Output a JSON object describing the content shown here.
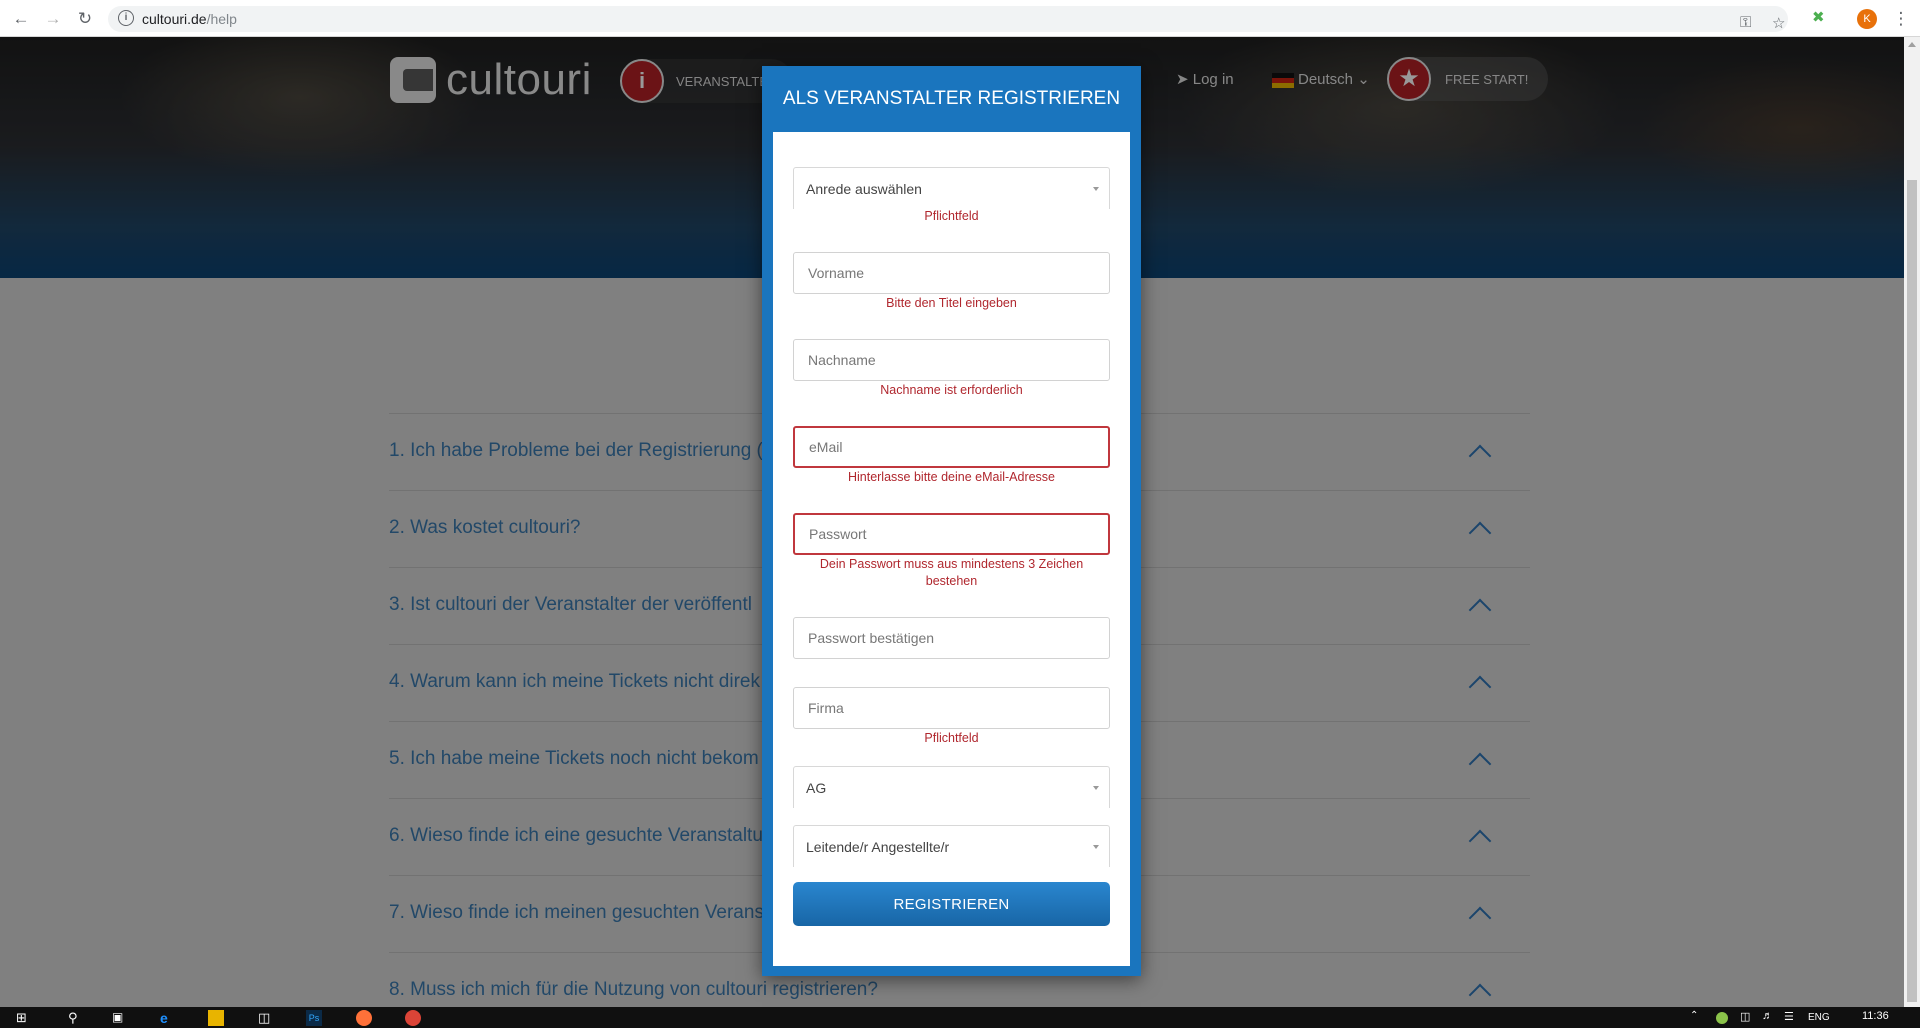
{
  "browser": {
    "url_host": "cultouri.de",
    "url_path": "/help",
    "avatar_letter": "K"
  },
  "header": {
    "logo_text": "cultouri",
    "veranstalter_label": "VERANSTALTER",
    "login_label": "Log in",
    "language_label": "Deutsch",
    "free_start_label": "FREE START!"
  },
  "faq": {
    "items": [
      {
        "question": "1. Ich habe Probleme bei der Registrierung ("
      },
      {
        "question": "2. Was kostet cultouri?"
      },
      {
        "question": "3. Ist cultouri der Veranstalter der veröffentl"
      },
      {
        "question": "4. Warum kann ich meine Tickets nicht direk"
      },
      {
        "question": "5. Ich habe meine Tickets noch nicht bekom"
      },
      {
        "question": "6. Wieso finde ich eine gesuchte Veranstaltu"
      },
      {
        "question": "7. Wieso finde ich meinen gesuchten Verans"
      },
      {
        "question": "8. Muss ich mich für die Nutzung von cultouri registrieren?"
      }
    ]
  },
  "modal": {
    "title": "ALS VERANSTALTER REGISTRIEREN",
    "salutation_select": "Anrede auswählen",
    "salutation_error": "Pflichtfeld",
    "firstname_placeholder": "Vorname",
    "firstname_error": "Bitte den Titel eingeben",
    "lastname_placeholder": "Nachname",
    "lastname_error": "Nachname ist erforderlich",
    "email_placeholder": "eMail",
    "email_error": "Hinterlasse bitte deine eMail-Adresse",
    "password_placeholder": "Passwort",
    "password_error": "Dein Passwort muss aus mindestens 3 Zeichen bestehen",
    "password_confirm_placeholder": "Passwort bestätigen",
    "company_placeholder": "Firma",
    "company_error": "Pflichtfeld",
    "company_type_select": "AG",
    "position_select": "Leitende/r Angestellte/r",
    "submit_label": "REGISTRIEREN"
  },
  "taskbar": {
    "language": "ENG",
    "time": "11:36"
  },
  "colors": {
    "modal_blue": "#1a75be",
    "error_red": "#b0272e",
    "faq_text": "#3a78ad"
  }
}
